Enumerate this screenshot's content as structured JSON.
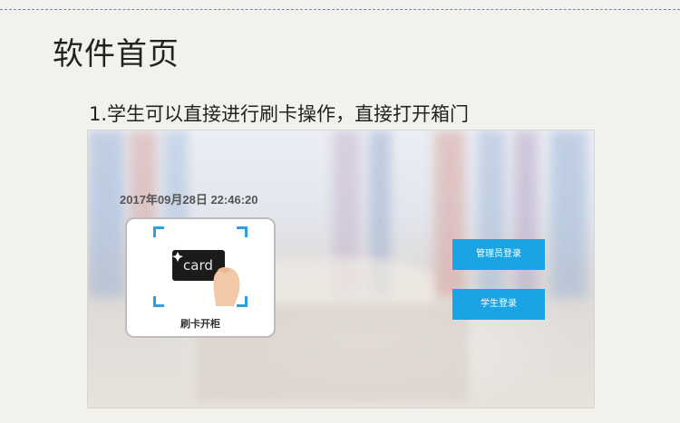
{
  "doc": {
    "title": "软件首页",
    "caption": "1.学生可以直接进行刷卡操作，直接打开箱门"
  },
  "screen": {
    "datetime": "2017年09月28日 22:46:20",
    "card_panel": {
      "card_text": "card",
      "label": "刷卡开柜"
    },
    "buttons": {
      "admin_login": "管理员登录",
      "student_login": "学生登录"
    },
    "colors": {
      "accent": "#1aa4e4",
      "frame_corners": "#2b9fe0"
    }
  }
}
